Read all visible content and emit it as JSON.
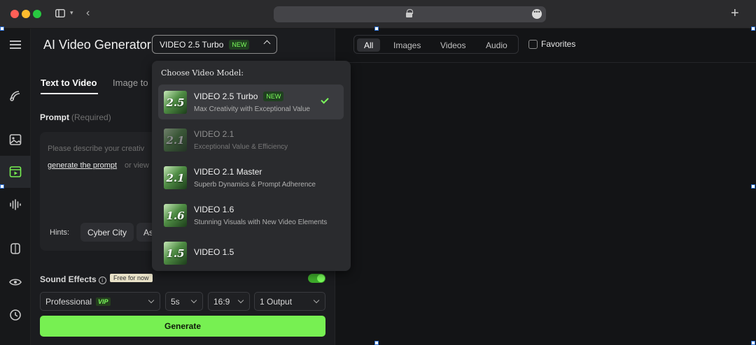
{
  "app": {
    "title": "AI Video Generator",
    "accent": "#77f052"
  },
  "model_select": {
    "current": "VIDEO 2.5 Turbo",
    "badge": "NEW"
  },
  "tabs": [
    {
      "label": "Text to Video",
      "active": true
    },
    {
      "label": "Image to",
      "active": false
    }
  ],
  "prompt": {
    "label": "Prompt",
    "required": "(Required)",
    "placeholder": "Please describe your creativ",
    "generate_link": "generate the prompt",
    "or_view": "or view"
  },
  "hints": {
    "label": "Hints:",
    "chips": [
      "Cyber City",
      "As"
    ]
  },
  "sound": {
    "label": "Sound Effects",
    "info": "i",
    "free": "Free for now",
    "enabled": true
  },
  "options": {
    "quality": {
      "value": "Professional",
      "badge": "VIP"
    },
    "duration": "5s",
    "ratio": "16:9",
    "outputs": "1 Output"
  },
  "generate_label": "Generate",
  "media_filters": {
    "items": [
      "All",
      "Images",
      "Videos",
      "Audio"
    ],
    "active": "All",
    "favorites": "Favorites"
  },
  "dropdown": {
    "header": "Choose Video Model:",
    "models": [
      {
        "thumb": "2.5",
        "name": "VIDEO 2.5 Turbo",
        "badge": "NEW",
        "desc": "Max Creativity with Exceptional Value",
        "selected": true,
        "dim": false
      },
      {
        "thumb": "2.1",
        "name": "VIDEO 2.1",
        "badge": "",
        "desc": "Exceptional Value & Efficiency",
        "selected": false,
        "dim": true
      },
      {
        "thumb": "2.1",
        "name": "VIDEO 2.1 Master",
        "badge": "",
        "desc": "Superb Dynamics & Prompt Adherence",
        "selected": false,
        "dim": false
      },
      {
        "thumb": "1.6",
        "name": "VIDEO 1.6",
        "badge": "",
        "desc": "Stunning Visuals with New Video Elements",
        "selected": false,
        "dim": false
      },
      {
        "thumb": "1.5",
        "name": "VIDEO 1.5",
        "badge": "",
        "desc": "",
        "selected": false,
        "dim": false
      }
    ]
  }
}
